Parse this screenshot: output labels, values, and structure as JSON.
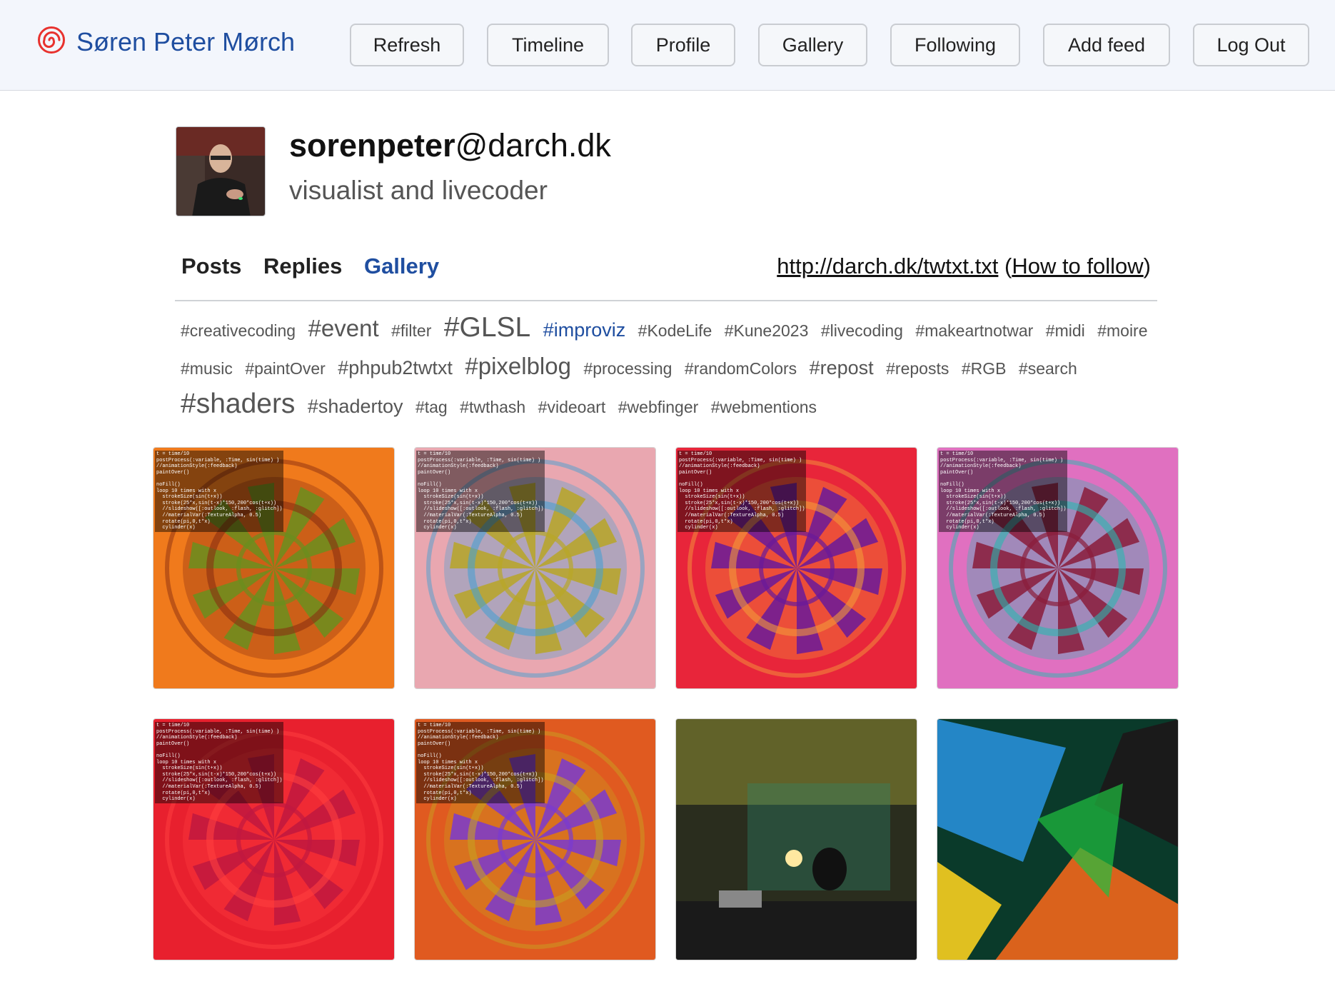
{
  "header": {
    "site_title": "Søren Peter Mørch",
    "logo_icon": "spiral-icon",
    "buttons": [
      "Refresh",
      "Timeline",
      "Profile",
      "Gallery",
      "Following",
      "Add feed",
      "Log Out"
    ]
  },
  "profile": {
    "nick": "sorenpeter",
    "domain": "@darch.dk",
    "bio": "visualist and livecoder",
    "tabs": [
      "Posts",
      "Replies",
      "Gallery"
    ],
    "active_tab": "Gallery",
    "feed_url": "http://darch.dk/twtxt.txt",
    "how_to_follow": "How to follow"
  },
  "tags": [
    {
      "text": "#creativecoding",
      "size": 1
    },
    {
      "text": "#event",
      "size": 3
    },
    {
      "text": "#filter",
      "size": 1
    },
    {
      "text": "#GLSL",
      "size": 4
    },
    {
      "text": "#improviz",
      "size": 2,
      "highlight": true
    },
    {
      "text": "#KodeLife",
      "size": 1
    },
    {
      "text": "#Kune2023",
      "size": 1
    },
    {
      "text": "#livecoding",
      "size": 1
    },
    {
      "text": "#makeartnotwar",
      "size": 1
    },
    {
      "text": "#midi",
      "size": 1
    },
    {
      "text": "#moire",
      "size": 1
    },
    {
      "text": "#music",
      "size": 1
    },
    {
      "text": "#paintOver",
      "size": 1
    },
    {
      "text": "#phpub2twtxt",
      "size": 2
    },
    {
      "text": "#pixelblog",
      "size": 3
    },
    {
      "text": "#processing",
      "size": 1
    },
    {
      "text": "#randomColors",
      "size": 1
    },
    {
      "text": "#repost",
      "size": 2
    },
    {
      "text": "#reposts",
      "size": 1
    },
    {
      "text": "#RGB",
      "size": 1
    },
    {
      "text": "#search",
      "size": 1
    },
    {
      "text": "#shaders",
      "size": 4
    },
    {
      "text": "#shadertoy",
      "size": 2
    },
    {
      "text": "#tag",
      "size": 1
    },
    {
      "text": "#twthash",
      "size": 1
    },
    {
      "text": "#videoart",
      "size": 1
    },
    {
      "text": "#webfinger",
      "size": 1
    },
    {
      "text": "#webmentions",
      "size": 1
    }
  ],
  "gallery_code": "t = time/10\npostProcess(:variable, :Time, sin(time) )\n//animationStyle(:feedback)\npaintOver()\n\nnoFill()\nloop 10 times with x\n  strokeSize(sin(t+x))\n  stroke(25*x,sin(t-x)*150,200*cos(t+x))\n  //slideshow([:outlook, :flash, :glitch])\n  //materialVar(:TextureAlpha, 0.5)\n  rotate(pi,0,t*x)\n  cylinder(x)",
  "gallery": [
    {
      "bg": "#f07a1c",
      "c1": "#6a8f1e",
      "c2": "#8a2e10",
      "code": true
    },
    {
      "bg": "#e9a7b0",
      "c1": "#b8a626",
      "c2": "#4aa0d0",
      "code": true
    },
    {
      "bg": "#e8253a",
      "c1": "#6a1a9a",
      "c2": "#f39a3a",
      "code": true
    },
    {
      "bg": "#e070c0",
      "c1": "#8a1c3a",
      "c2": "#2ab8b0",
      "code": true
    },
    {
      "bg": "#e8202e",
      "c1": "#c01840",
      "c2": "#ff4040",
      "code": true
    },
    {
      "bg": "#e05a20",
      "c1": "#7a3ad0",
      "c2": "#c8a020",
      "code": true
    },
    {
      "bg": "#2a2d1e",
      "c1": "#c9c640",
      "c2": "#2a8a70",
      "code": false
    },
    {
      "bg": "#0a3a2a",
      "c1": "#ff6a1a",
      "c2": "#2a9aee",
      "code": false
    }
  ]
}
